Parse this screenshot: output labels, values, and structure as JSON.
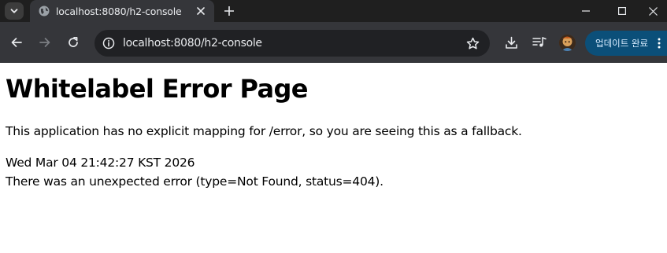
{
  "browser": {
    "tab": {
      "title": "localhost:8080/h2-console",
      "favicon": "globe-icon"
    },
    "address_bar": {
      "host": "localhost",
      "path": ":8080/h2-console"
    },
    "update_button_label": "업데이트 완료",
    "icons": {
      "tab_search": "chevron-down-icon",
      "tab_close": "close-icon",
      "new_tab": "plus-icon",
      "minimize": "minimize-icon",
      "maximize": "maximize-icon",
      "close": "close-icon",
      "back": "arrow-left-icon",
      "forward": "arrow-right-icon",
      "reload": "reload-icon",
      "site_info": "info-icon",
      "bookmark": "star-icon",
      "downloads": "download-icon",
      "media": "media-queue-icon",
      "profile": "avatar",
      "menu": "kebab-menu-icon"
    },
    "colors": {
      "tabstrip": "#1f1f1f",
      "toolbar": "#35363a",
      "omnibox": "#202124",
      "update_button": "#0b4f79"
    }
  },
  "page": {
    "title": "Whitelabel Error Page",
    "description": "This application has no explicit mapping for /error, so you are seeing this as a fallback.",
    "timestamp": "Wed Mar 04 21:42:27 KST 2026",
    "error_message": "There was an unexpected error (type=Not Found, status=404)."
  }
}
